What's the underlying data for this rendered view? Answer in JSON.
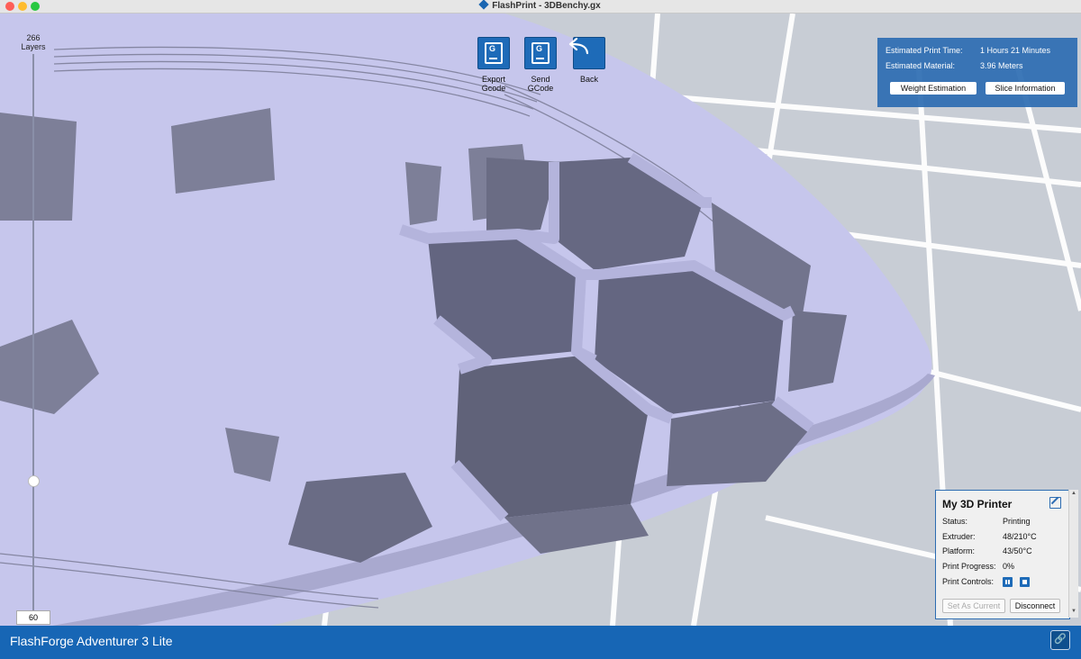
{
  "window": {
    "title": "FlashPrint - 3DBenchy.gx"
  },
  "layers": {
    "count_text": "266",
    "label": "Layers",
    "current_value": "60"
  },
  "toolbar": {
    "export_label": "Export\nGcode",
    "send_label": "Send\nGCode",
    "back_label": "Back",
    "export_icon_letter": "G",
    "send_icon_letter": "G"
  },
  "estimate": {
    "time_label": "Estimated Print Time:",
    "time_value": "1 Hours 21 Minutes",
    "material_label": "Estimated Material:",
    "material_value": "3.96 Meters",
    "weight_button": "Weight Estimation",
    "slice_button": "Slice Information"
  },
  "printer": {
    "title": "My 3D Printer",
    "status_label": "Status:",
    "status_value": "Printing",
    "extruder_label": "Extruder:",
    "extruder_value": "48/210°C",
    "platform_label": "Platform:",
    "platform_value": "43/50°C",
    "progress_label": "Print Progress:",
    "progress_value": "0%",
    "controls_label": "Print Controls:",
    "set_current_button": "Set As Current",
    "disconnect_button": "Disconnect"
  },
  "statusbar": {
    "machine_name": "FlashForge Adventurer 3 Lite"
  },
  "colors": {
    "accent": "#1766b5",
    "model": "#c6c6ec",
    "model_shadow": "#686a80",
    "grid": "#ffffff"
  }
}
